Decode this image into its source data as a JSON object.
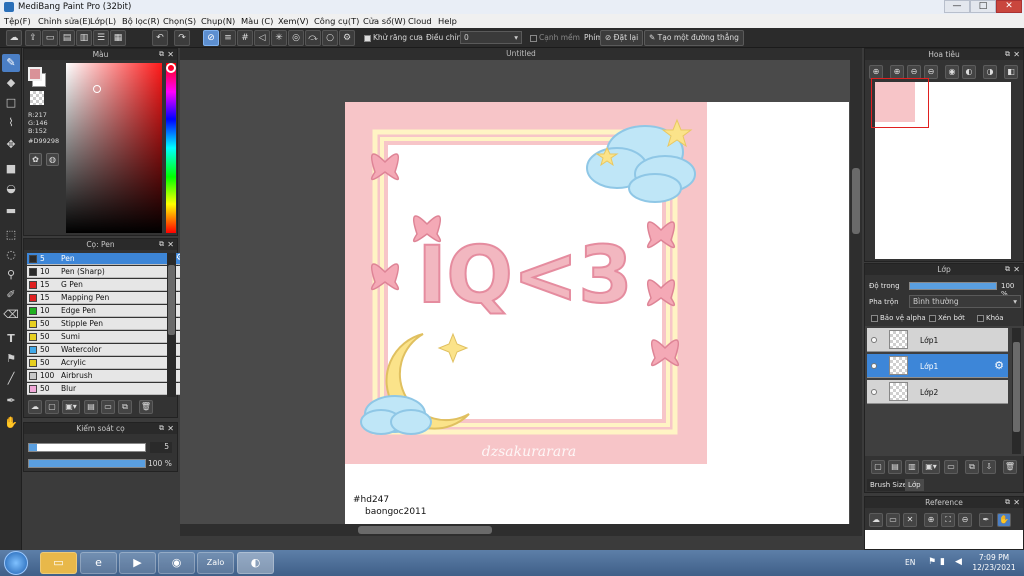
{
  "window": {
    "title": "MediBang Paint Pro (32bit)",
    "minimize": "—",
    "maximize": "□",
    "close": "✕"
  },
  "menu": [
    "Tệp(F)",
    "Chỉnh sửa(E)",
    "Lớp(L)",
    "Bộ lọc(R)",
    "Chọn(S)",
    "Chụp(N)",
    "Màu (C)",
    "Xem(V)",
    "Công cụ(T)",
    "Cửa sổ(W)",
    "Cloud",
    "Help"
  ],
  "toolbar": {
    "antialias_label": "Khử răng cưa",
    "adjust_label": "Điều chỉnh",
    "adjust_value": "0",
    "soft_edge_label": "Cạnh mềm",
    "key_label": "Phím",
    "reset_label": "Đặt lại",
    "straight_line_label": "Tạo một đường thẳng"
  },
  "color_panel": {
    "title": "Màu",
    "r": "R:217",
    "g": "G:146",
    "b": "B:152",
    "hex": "#D99298",
    "current_color": "#D99298"
  },
  "brush_panel": {
    "title": "Cọ: Pen",
    "brushes": [
      {
        "size": "5",
        "name": "Pen",
        "color": "#2a2a2a"
      },
      {
        "size": "10",
        "name": "Pen (Sharp)",
        "color": "#2a2a2a"
      },
      {
        "size": "15",
        "name": "G Pen",
        "color": "#e02020"
      },
      {
        "size": "15",
        "name": "Mapping Pen",
        "color": "#e02020"
      },
      {
        "size": "10",
        "name": "Edge Pen",
        "color": "#20b020"
      },
      {
        "size": "50",
        "name": "Stipple Pen",
        "color": "#e8d020"
      },
      {
        "size": "50",
        "name": "Sumi",
        "color": "#e8d020"
      },
      {
        "size": "50",
        "name": "Watercolor",
        "color": "#40a8e8"
      },
      {
        "size": "50",
        "name": "Acrylic",
        "color": "#e8d020"
      },
      {
        "size": "100",
        "name": "Airbrush",
        "color": "#c8c8c8"
      },
      {
        "size": "50",
        "name": "Blur",
        "color": "#f0a8d8"
      }
    ]
  },
  "brush_control": {
    "title": "Kiểm soát cọ",
    "size": "5",
    "size_fraction": 0.05,
    "opacity": "100 %",
    "opacity_fraction": 1.0
  },
  "canvas": {
    "tab_title": "Untitled",
    "watermark": "dzsakurarara",
    "caption_line1": "#hd247",
    "caption_line2": "baongoc2011",
    "art_text": "IQ<3"
  },
  "navigator": {
    "title": "Hoa tiêu"
  },
  "layer_panel": {
    "title": "Lớp",
    "opacity_label": "Độ trong",
    "opacity_value": "100 %",
    "blend_label": "Pha trộn",
    "blend_value": "Bình thường",
    "protect_alpha": "Bảo vệ alpha",
    "clip": "Xén bớt",
    "lock": "Khóa",
    "layers": [
      {
        "name": "Lớp1",
        "selected": false
      },
      {
        "name": "Lớp1",
        "selected": true
      },
      {
        "name": "Lớp2",
        "selected": false
      }
    ],
    "bottom_tab_1": "Brush Size",
    "bottom_tab_2": "Lớp"
  },
  "reference_panel": {
    "title": "Reference"
  },
  "taskbar": {
    "lang": "EN",
    "time": "7:09 PM",
    "date": "12/23/2021"
  }
}
